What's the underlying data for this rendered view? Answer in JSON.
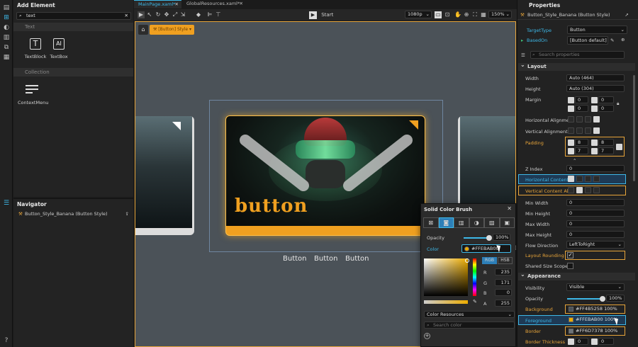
{
  "add_element": {
    "title": "Add Element",
    "search_value": "text",
    "group_text": "Text",
    "items": [
      {
        "label": "TextBlock",
        "icon": "T"
      },
      {
        "label": "TextBox",
        "icon": "A|"
      }
    ],
    "group_collection": "Collection",
    "collection_items": [
      {
        "label": "ContextMenu"
      }
    ]
  },
  "navigator": {
    "title": "Navigator",
    "item": "Button_Style_Banana (Button Style)"
  },
  "tabs": [
    {
      "label": "MainPage.xaml*"
    },
    {
      "label": "GlobalResources.xaml*"
    }
  ],
  "toolbar": {
    "start_label": "Start",
    "resolution": "1080p",
    "zoom": "150%"
  },
  "breadcrumb": {
    "style_chip": "[Button] Style"
  },
  "canvas": {
    "button_text": "button",
    "captions": [
      "Button",
      "Button",
      "Button"
    ],
    "accent": "#FFEBAB00"
  },
  "properties": {
    "title": "Properties",
    "target_name": "Button_Style_Banana (Button Style)",
    "target_type_label": "TargetType",
    "target_type_value": "Button",
    "based_on_label": "BasedOn",
    "based_on_value": "[Button default]",
    "search_placeholder": "Search properties",
    "layout_title": "Layout",
    "width_label": "Width",
    "width_value": "Auto (464)",
    "height_label": "Height",
    "height_value": "Auto (304)",
    "margin_label": "Margin",
    "margin_values": [
      "0",
      "0",
      "0",
      "0"
    ],
    "halign_label": "Horizontal Alignme...",
    "valign_label": "Vertical Alignment",
    "padding_label": "Padding",
    "padding_values": [
      "8",
      "8",
      "7",
      "7"
    ],
    "zindex_label": "Z Index",
    "zindex_value": "0",
    "hcontent_label": "Horizontal Content...",
    "vcontent_label": "Vertical Content Al...",
    "minwidth_label": "Min Width",
    "minwidth_value": "0",
    "minheight_label": "Min Height",
    "minheight_value": "0",
    "maxwidth_label": "Max Width",
    "maxwidth_value": "0",
    "maxheight_label": "Max Height",
    "maxheight_value": "0",
    "flow_label": "Flow Direction",
    "flow_value": "LeftToRight",
    "rounding_label": "Layout Rounding",
    "sizescope_label": "Shared Size Scope",
    "appearance_title": "Appearance",
    "visibility_label": "Visibility",
    "visibility_value": "Visible",
    "opacity_label": "Opacity",
    "opacity_value": "100%",
    "opacity_fraction": 1.0,
    "background_label": "Background",
    "background_value": "#FF4B5258",
    "background_pct": "100%",
    "background_color": "#4B5258",
    "foreground_label": "Foreground",
    "foreground_value": "#FFEBAB00",
    "foreground_pct": "100%",
    "foreground_color": "#EBAB00",
    "border_label": "Border",
    "border_value": "#FF6D7378",
    "border_pct": "100%",
    "border_color": "#6D7378",
    "thickness_label": "Border Thickness",
    "thickness_values": [
      "0",
      "0"
    ]
  },
  "brush": {
    "title": "Solid Color Brush",
    "opacity_label": "Opacity",
    "opacity_value": "100%",
    "opacity_fraction": 1.0,
    "color_label": "Color",
    "color_value": "#FFEBAB00",
    "rgb_tab": "RGB",
    "hsb_tab": "HSB",
    "r_label": "R",
    "r_value": "235",
    "g_label": "G",
    "g_value": "171",
    "b_label": "B",
    "b_value": "0",
    "a_label": "A",
    "a_value": "255",
    "resources_label": "Color Resources",
    "search_placeholder": "Search color"
  }
}
